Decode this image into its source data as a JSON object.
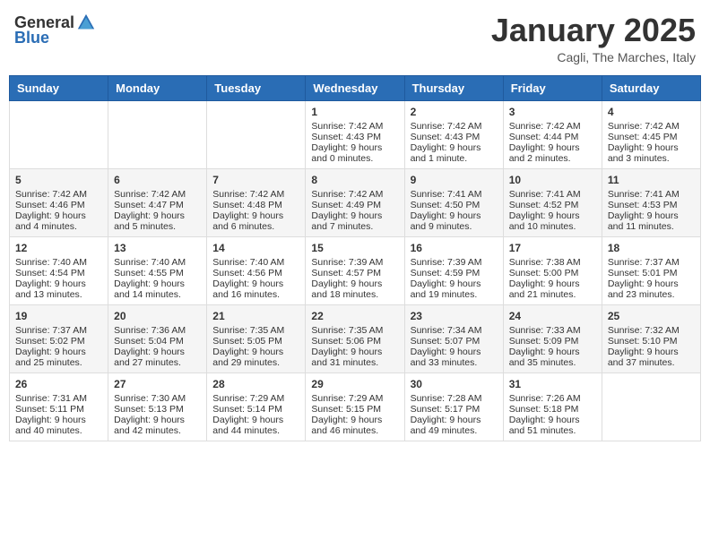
{
  "header": {
    "logo_general": "General",
    "logo_blue": "Blue",
    "month_title": "January 2025",
    "location": "Cagli, The Marches, Italy"
  },
  "weekdays": [
    "Sunday",
    "Monday",
    "Tuesday",
    "Wednesday",
    "Thursday",
    "Friday",
    "Saturday"
  ],
  "weeks": [
    [
      {
        "day": "",
        "content": ""
      },
      {
        "day": "",
        "content": ""
      },
      {
        "day": "",
        "content": ""
      },
      {
        "day": "1",
        "content": "Sunrise: 7:42 AM\nSunset: 4:43 PM\nDaylight: 9 hours and 0 minutes."
      },
      {
        "day": "2",
        "content": "Sunrise: 7:42 AM\nSunset: 4:43 PM\nDaylight: 9 hours and 1 minute."
      },
      {
        "day": "3",
        "content": "Sunrise: 7:42 AM\nSunset: 4:44 PM\nDaylight: 9 hours and 2 minutes."
      },
      {
        "day": "4",
        "content": "Sunrise: 7:42 AM\nSunset: 4:45 PM\nDaylight: 9 hours and 3 minutes."
      }
    ],
    [
      {
        "day": "5",
        "content": "Sunrise: 7:42 AM\nSunset: 4:46 PM\nDaylight: 9 hours and 4 minutes."
      },
      {
        "day": "6",
        "content": "Sunrise: 7:42 AM\nSunset: 4:47 PM\nDaylight: 9 hours and 5 minutes."
      },
      {
        "day": "7",
        "content": "Sunrise: 7:42 AM\nSunset: 4:48 PM\nDaylight: 9 hours and 6 minutes."
      },
      {
        "day": "8",
        "content": "Sunrise: 7:42 AM\nSunset: 4:49 PM\nDaylight: 9 hours and 7 minutes."
      },
      {
        "day": "9",
        "content": "Sunrise: 7:41 AM\nSunset: 4:50 PM\nDaylight: 9 hours and 9 minutes."
      },
      {
        "day": "10",
        "content": "Sunrise: 7:41 AM\nSunset: 4:52 PM\nDaylight: 9 hours and 10 minutes."
      },
      {
        "day": "11",
        "content": "Sunrise: 7:41 AM\nSunset: 4:53 PM\nDaylight: 9 hours and 11 minutes."
      }
    ],
    [
      {
        "day": "12",
        "content": "Sunrise: 7:40 AM\nSunset: 4:54 PM\nDaylight: 9 hours and 13 minutes."
      },
      {
        "day": "13",
        "content": "Sunrise: 7:40 AM\nSunset: 4:55 PM\nDaylight: 9 hours and 14 minutes."
      },
      {
        "day": "14",
        "content": "Sunrise: 7:40 AM\nSunset: 4:56 PM\nDaylight: 9 hours and 16 minutes."
      },
      {
        "day": "15",
        "content": "Sunrise: 7:39 AM\nSunset: 4:57 PM\nDaylight: 9 hours and 18 minutes."
      },
      {
        "day": "16",
        "content": "Sunrise: 7:39 AM\nSunset: 4:59 PM\nDaylight: 9 hours and 19 minutes."
      },
      {
        "day": "17",
        "content": "Sunrise: 7:38 AM\nSunset: 5:00 PM\nDaylight: 9 hours and 21 minutes."
      },
      {
        "day": "18",
        "content": "Sunrise: 7:37 AM\nSunset: 5:01 PM\nDaylight: 9 hours and 23 minutes."
      }
    ],
    [
      {
        "day": "19",
        "content": "Sunrise: 7:37 AM\nSunset: 5:02 PM\nDaylight: 9 hours and 25 minutes."
      },
      {
        "day": "20",
        "content": "Sunrise: 7:36 AM\nSunset: 5:04 PM\nDaylight: 9 hours and 27 minutes."
      },
      {
        "day": "21",
        "content": "Sunrise: 7:35 AM\nSunset: 5:05 PM\nDaylight: 9 hours and 29 minutes."
      },
      {
        "day": "22",
        "content": "Sunrise: 7:35 AM\nSunset: 5:06 PM\nDaylight: 9 hours and 31 minutes."
      },
      {
        "day": "23",
        "content": "Sunrise: 7:34 AM\nSunset: 5:07 PM\nDaylight: 9 hours and 33 minutes."
      },
      {
        "day": "24",
        "content": "Sunrise: 7:33 AM\nSunset: 5:09 PM\nDaylight: 9 hours and 35 minutes."
      },
      {
        "day": "25",
        "content": "Sunrise: 7:32 AM\nSunset: 5:10 PM\nDaylight: 9 hours and 37 minutes."
      }
    ],
    [
      {
        "day": "26",
        "content": "Sunrise: 7:31 AM\nSunset: 5:11 PM\nDaylight: 9 hours and 40 minutes."
      },
      {
        "day": "27",
        "content": "Sunrise: 7:30 AM\nSunset: 5:13 PM\nDaylight: 9 hours and 42 minutes."
      },
      {
        "day": "28",
        "content": "Sunrise: 7:29 AM\nSunset: 5:14 PM\nDaylight: 9 hours and 44 minutes."
      },
      {
        "day": "29",
        "content": "Sunrise: 7:29 AM\nSunset: 5:15 PM\nDaylight: 9 hours and 46 minutes."
      },
      {
        "day": "30",
        "content": "Sunrise: 7:28 AM\nSunset: 5:17 PM\nDaylight: 9 hours and 49 minutes."
      },
      {
        "day": "31",
        "content": "Sunrise: 7:26 AM\nSunset: 5:18 PM\nDaylight: 9 hours and 51 minutes."
      },
      {
        "day": "",
        "content": ""
      }
    ]
  ]
}
